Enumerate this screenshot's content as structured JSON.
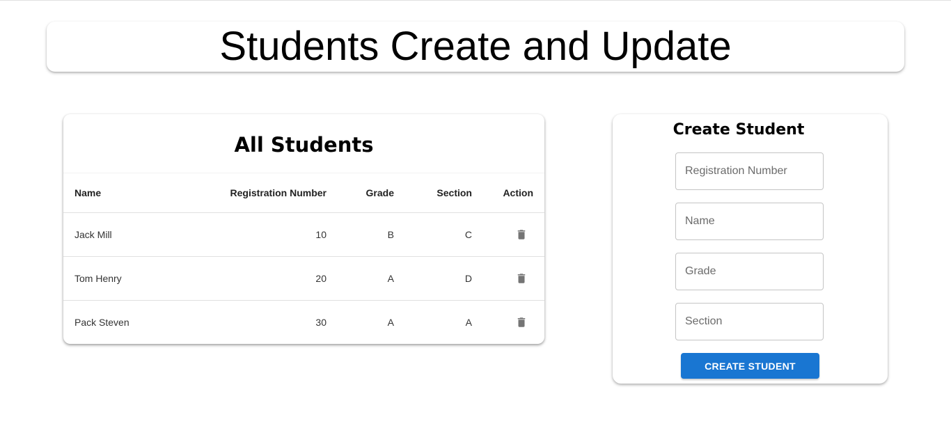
{
  "header": {
    "title": "Students Create and Update"
  },
  "students": {
    "title": "All Students",
    "columns": [
      "Name",
      "Registration Number",
      "Grade",
      "Section",
      "Action"
    ],
    "rows": [
      {
        "name": "Jack Mill",
        "registration": "10",
        "grade": "B",
        "section": "C"
      },
      {
        "name": "Tom Henry",
        "registration": "20",
        "grade": "A",
        "section": "D"
      },
      {
        "name": "Pack Steven",
        "registration": "30",
        "grade": "A",
        "section": "A"
      }
    ],
    "action_icon": "trash-icon"
  },
  "create": {
    "title": "Create Student",
    "registration_placeholder": "Registration Number",
    "name_placeholder": "Name",
    "grade_placeholder": "Grade",
    "section_placeholder": "Section",
    "submit_label": "CREATE STUDENT"
  },
  "colors": {
    "primary": "#1976d2",
    "icon": "#757575"
  }
}
